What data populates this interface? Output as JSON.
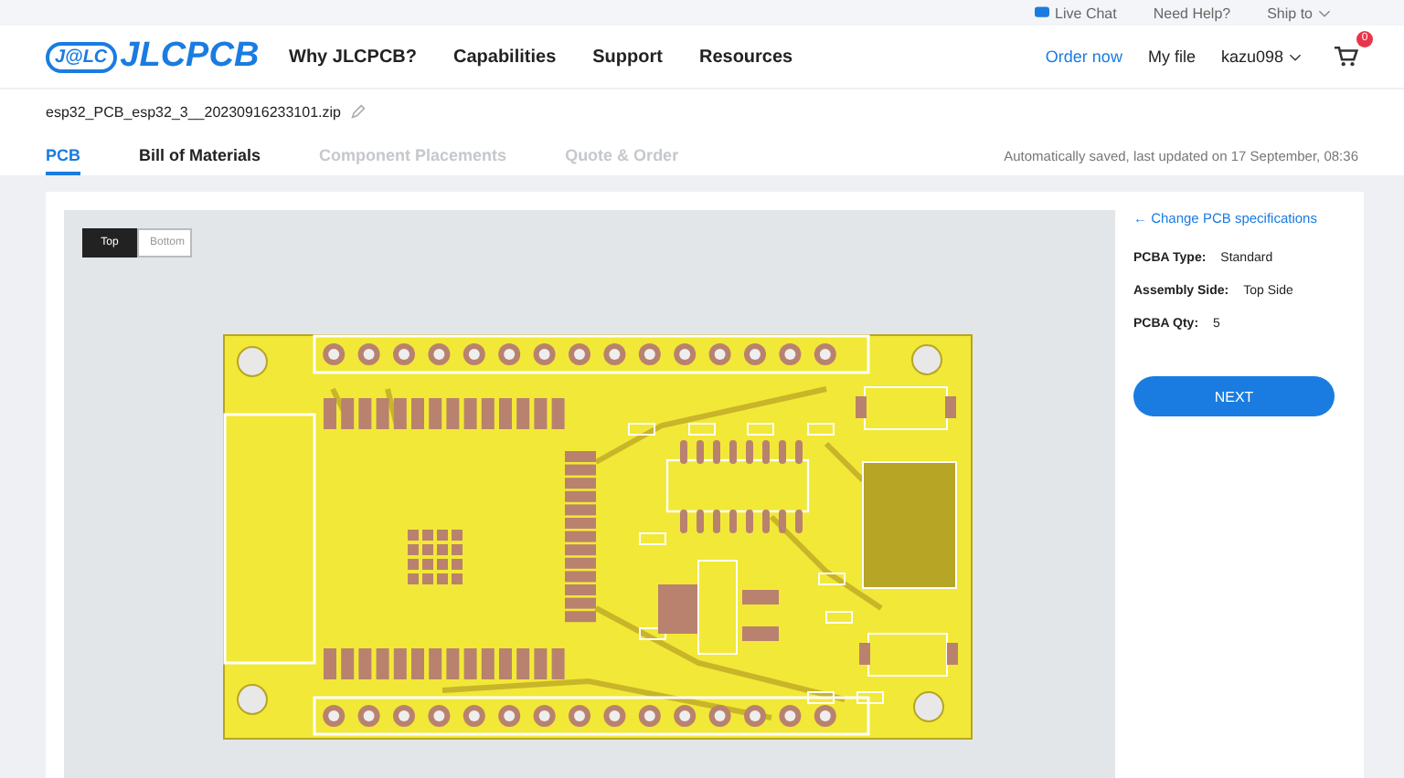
{
  "utility_links": [
    {
      "label": "Live Chat",
      "kind": "chat"
    },
    {
      "label": "Need Help?",
      "kind": "plain"
    },
    {
      "label": "Ship to",
      "kind": "dropdown"
    }
  ],
  "header": {
    "logo": {
      "badge": "J@LC",
      "name": "JLCPCB"
    },
    "nav": [
      "Why JLCPCB?",
      "Capabilities",
      "Support",
      "Resources"
    ],
    "order_link": "Order now",
    "my_file": "My file",
    "user": "kazu098",
    "cart_count": "0"
  },
  "file": {
    "name": "esp32_PCB_esp32_3__20230916233101.zip"
  },
  "tabs": [
    {
      "label": "PCB",
      "selected": true,
      "disabled": false
    },
    {
      "label": "Bill of Materials",
      "selected": false,
      "disabled": false
    },
    {
      "label": "Component Placements",
      "selected": false,
      "disabled": true
    },
    {
      "label": "Quote & Order",
      "selected": false,
      "disabled": true
    }
  ],
  "save_status": "Automatically saved, last updated on 17 September, 08:36",
  "viewer": {
    "sides": [
      {
        "label": "Top",
        "selected": true
      },
      {
        "label": "Bottom",
        "selected": false
      }
    ]
  },
  "panel": {
    "change_link": "← Change PCB specifications",
    "specs": [
      {
        "label": "PCBA Type:",
        "value": "Standard"
      },
      {
        "label": "Assembly Side:",
        "value": "Top Side"
      },
      {
        "label": "PCBA Qty:",
        "value": "5"
      }
    ],
    "button": "NEXT"
  }
}
